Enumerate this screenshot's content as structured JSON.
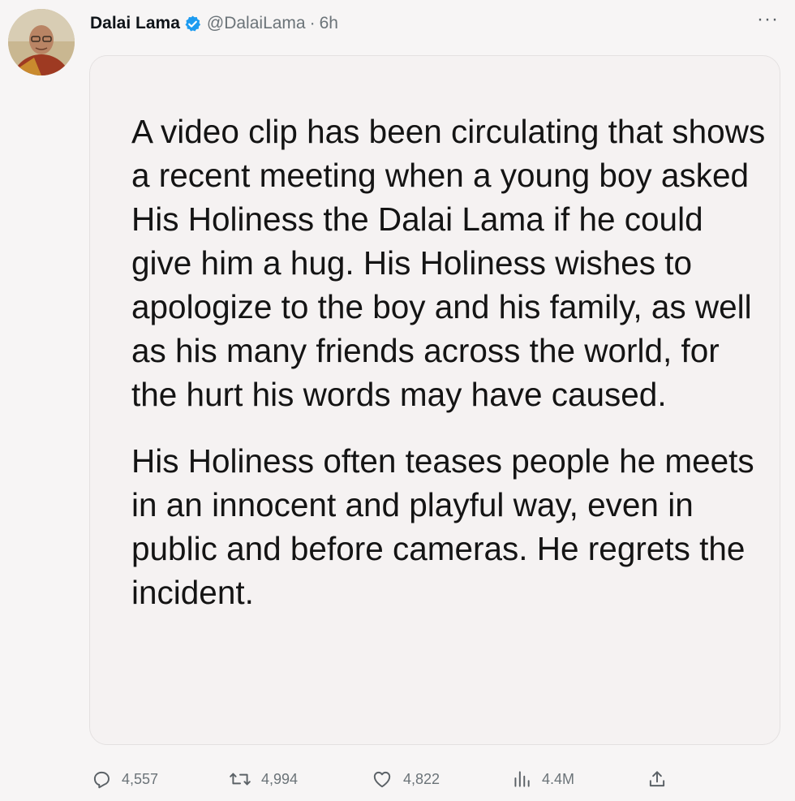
{
  "author": {
    "display_name": "Dalai Lama",
    "handle": "@DalaiLama",
    "separator": "·",
    "time": "6h",
    "verified": true,
    "avatar_icon": "avatar-image"
  },
  "more_label": "···",
  "body": {
    "paragraph_1": "A video clip has been circulating that shows a recent meeting when a young boy asked His Holiness the Dalai Lama if he could give him a hug. His Holiness wishes to apologize to the boy and his family, as well as his many friends across the world, for the hurt his words may have caused.",
    "paragraph_2": "His Holiness often teases people he meets in an innocent and playful way, even in public and before cameras. He regrets the incident."
  },
  "actions": {
    "replies": "4,557",
    "retweets": "4,994",
    "likes": "4,822",
    "views": "4.4M"
  },
  "colors": {
    "background": "#f7f5f5",
    "card_background": "#f5f2f2",
    "verified_blue": "#1d9bf0",
    "muted_text": "#6b7378"
  },
  "icons": {
    "reply": "reply-icon",
    "retweet": "retweet-icon",
    "like": "heart-icon",
    "views": "views-icon",
    "share": "share-icon",
    "verified": "verified-badge-icon",
    "more": "more-icon"
  }
}
